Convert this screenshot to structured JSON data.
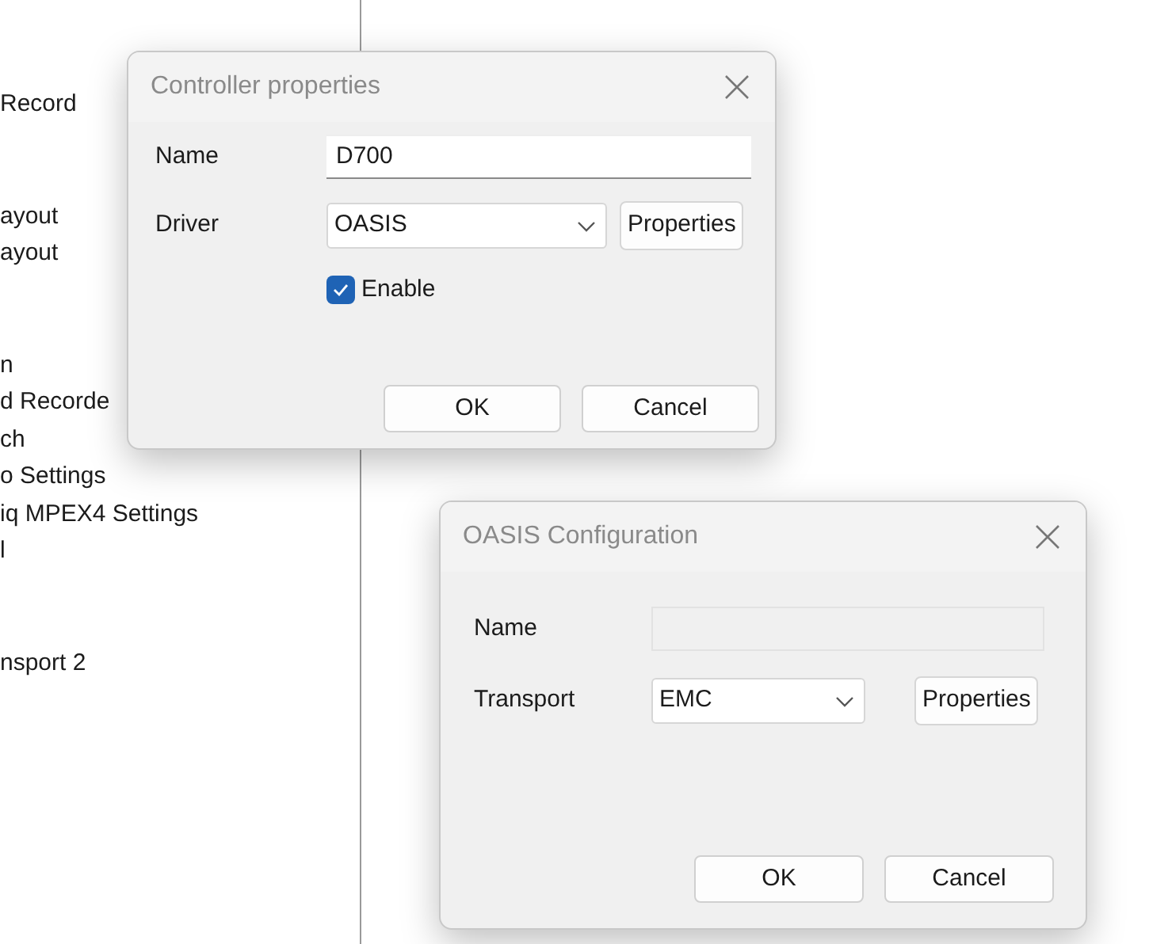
{
  "background_list": {
    "sections": [
      {
        "items": [
          "Record"
        ]
      },
      {
        "items": [
          "ayout",
          "ayout"
        ]
      },
      {
        "items": [
          "n",
          "d Recorde",
          "ch",
          "o Settings",
          "iq MPEX4 Settings",
          "l"
        ]
      },
      {
        "items": [
          "nsport 2"
        ]
      }
    ]
  },
  "dialogs": [
    {
      "title": "Controller properties",
      "fields": [
        {
          "kind": "text",
          "label": "Name",
          "value": "D700"
        },
        {
          "kind": "dropdown",
          "label": "Driver",
          "value": "OASIS",
          "button": "Properties"
        },
        {
          "kind": "checkbox",
          "label": "Enable",
          "checked": true
        }
      ],
      "buttons": [
        "OK",
        "Cancel"
      ]
    },
    {
      "title": "OASIS Configuration",
      "fields": [
        {
          "kind": "text",
          "label": "Name",
          "disabled": true
        },
        {
          "kind": "dropdown",
          "label": "Transport",
          "value": "EMC",
          "button": "Properties"
        }
      ],
      "buttons": [
        "OK",
        "Cancel"
      ]
    }
  ]
}
